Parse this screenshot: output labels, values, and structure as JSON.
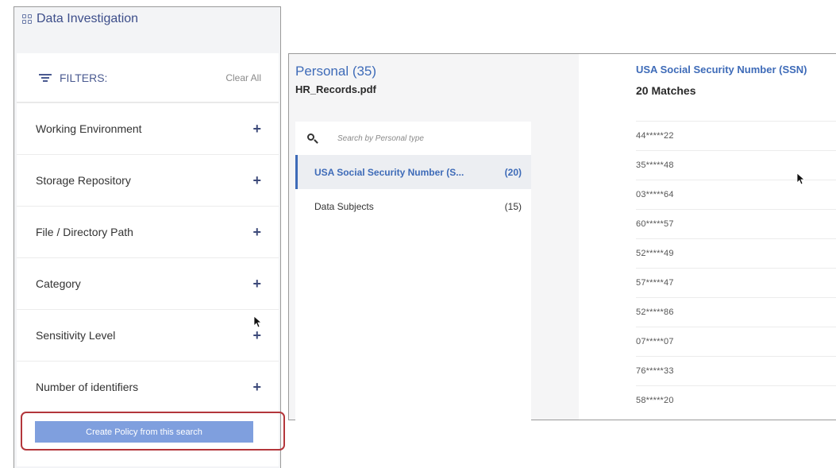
{
  "app": {
    "title": "Data Investigation",
    "title_icon": "grid-icon"
  },
  "filters": {
    "title": "FILTERS:",
    "clear_all": "Clear All",
    "items": [
      {
        "label": "Working Environment",
        "icon": "plus-icon"
      },
      {
        "label": "Storage Repository",
        "icon": "plus-icon"
      },
      {
        "label": "File / Directory Path",
        "icon": "plus-icon"
      },
      {
        "label": "Category",
        "icon": "plus-icon"
      },
      {
        "label": "Sensitivity Level",
        "icon": "plus-icon"
      },
      {
        "label": "Number of identifiers",
        "icon": "plus-icon"
      }
    ],
    "create_policy": "Create Policy from this search"
  },
  "details": {
    "personal_title": "Personal (35)",
    "file_name": "HR_Records.pdf",
    "search_placeholder": "Search by Personal type",
    "types": [
      {
        "label": "USA Social Security Number (S...",
        "count": "(20)",
        "active": true
      },
      {
        "label": "Data Subjects",
        "count": "(15)",
        "active": false
      }
    ],
    "selected_type_title": "USA Social Security Number (SSN)",
    "matches_label": "20 Matches",
    "matches": [
      "44*****22",
      "35*****48",
      "03*****64",
      "60*****57",
      "52*****49",
      "57*****47",
      "52*****86",
      "07*****07",
      "76*****33",
      "58*****20"
    ]
  },
  "colors": {
    "accent": "#3e6bb8",
    "button": "#7f9fde",
    "highlight_border": "#b3363b"
  }
}
